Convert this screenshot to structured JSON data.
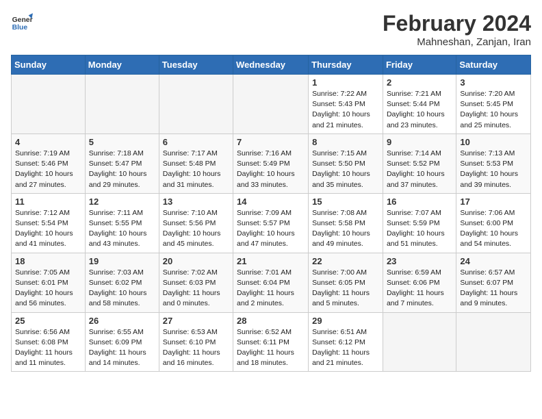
{
  "header": {
    "logo": "GeneralBlue",
    "month": "February 2024",
    "location": "Mahneshan, Zanjan, Iran"
  },
  "weekdays": [
    "Sunday",
    "Monday",
    "Tuesday",
    "Wednesday",
    "Thursday",
    "Friday",
    "Saturday"
  ],
  "weeks": [
    [
      {
        "day": "",
        "info": ""
      },
      {
        "day": "",
        "info": ""
      },
      {
        "day": "",
        "info": ""
      },
      {
        "day": "",
        "info": ""
      },
      {
        "day": "1",
        "info": "Sunrise: 7:22 AM\nSunset: 5:43 PM\nDaylight: 10 hours\nand 21 minutes."
      },
      {
        "day": "2",
        "info": "Sunrise: 7:21 AM\nSunset: 5:44 PM\nDaylight: 10 hours\nand 23 minutes."
      },
      {
        "day": "3",
        "info": "Sunrise: 7:20 AM\nSunset: 5:45 PM\nDaylight: 10 hours\nand 25 minutes."
      }
    ],
    [
      {
        "day": "4",
        "info": "Sunrise: 7:19 AM\nSunset: 5:46 PM\nDaylight: 10 hours\nand 27 minutes."
      },
      {
        "day": "5",
        "info": "Sunrise: 7:18 AM\nSunset: 5:47 PM\nDaylight: 10 hours\nand 29 minutes."
      },
      {
        "day": "6",
        "info": "Sunrise: 7:17 AM\nSunset: 5:48 PM\nDaylight: 10 hours\nand 31 minutes."
      },
      {
        "day": "7",
        "info": "Sunrise: 7:16 AM\nSunset: 5:49 PM\nDaylight: 10 hours\nand 33 minutes."
      },
      {
        "day": "8",
        "info": "Sunrise: 7:15 AM\nSunset: 5:50 PM\nDaylight: 10 hours\nand 35 minutes."
      },
      {
        "day": "9",
        "info": "Sunrise: 7:14 AM\nSunset: 5:52 PM\nDaylight: 10 hours\nand 37 minutes."
      },
      {
        "day": "10",
        "info": "Sunrise: 7:13 AM\nSunset: 5:53 PM\nDaylight: 10 hours\nand 39 minutes."
      }
    ],
    [
      {
        "day": "11",
        "info": "Sunrise: 7:12 AM\nSunset: 5:54 PM\nDaylight: 10 hours\nand 41 minutes."
      },
      {
        "day": "12",
        "info": "Sunrise: 7:11 AM\nSunset: 5:55 PM\nDaylight: 10 hours\nand 43 minutes."
      },
      {
        "day": "13",
        "info": "Sunrise: 7:10 AM\nSunset: 5:56 PM\nDaylight: 10 hours\nand 45 minutes."
      },
      {
        "day": "14",
        "info": "Sunrise: 7:09 AM\nSunset: 5:57 PM\nDaylight: 10 hours\nand 47 minutes."
      },
      {
        "day": "15",
        "info": "Sunrise: 7:08 AM\nSunset: 5:58 PM\nDaylight: 10 hours\nand 49 minutes."
      },
      {
        "day": "16",
        "info": "Sunrise: 7:07 AM\nSunset: 5:59 PM\nDaylight: 10 hours\nand 51 minutes."
      },
      {
        "day": "17",
        "info": "Sunrise: 7:06 AM\nSunset: 6:00 PM\nDaylight: 10 hours\nand 54 minutes."
      }
    ],
    [
      {
        "day": "18",
        "info": "Sunrise: 7:05 AM\nSunset: 6:01 PM\nDaylight: 10 hours\nand 56 minutes."
      },
      {
        "day": "19",
        "info": "Sunrise: 7:03 AM\nSunset: 6:02 PM\nDaylight: 10 hours\nand 58 minutes."
      },
      {
        "day": "20",
        "info": "Sunrise: 7:02 AM\nSunset: 6:03 PM\nDaylight: 11 hours\nand 0 minutes."
      },
      {
        "day": "21",
        "info": "Sunrise: 7:01 AM\nSunset: 6:04 PM\nDaylight: 11 hours\nand 2 minutes."
      },
      {
        "day": "22",
        "info": "Sunrise: 7:00 AM\nSunset: 6:05 PM\nDaylight: 11 hours\nand 5 minutes."
      },
      {
        "day": "23",
        "info": "Sunrise: 6:59 AM\nSunset: 6:06 PM\nDaylight: 11 hours\nand 7 minutes."
      },
      {
        "day": "24",
        "info": "Sunrise: 6:57 AM\nSunset: 6:07 PM\nDaylight: 11 hours\nand 9 minutes."
      }
    ],
    [
      {
        "day": "25",
        "info": "Sunrise: 6:56 AM\nSunset: 6:08 PM\nDaylight: 11 hours\nand 11 minutes."
      },
      {
        "day": "26",
        "info": "Sunrise: 6:55 AM\nSunset: 6:09 PM\nDaylight: 11 hours\nand 14 minutes."
      },
      {
        "day": "27",
        "info": "Sunrise: 6:53 AM\nSunset: 6:10 PM\nDaylight: 11 hours\nand 16 minutes."
      },
      {
        "day": "28",
        "info": "Sunrise: 6:52 AM\nSunset: 6:11 PM\nDaylight: 11 hours\nand 18 minutes."
      },
      {
        "day": "29",
        "info": "Sunrise: 6:51 AM\nSunset: 6:12 PM\nDaylight: 11 hours\nand 21 minutes."
      },
      {
        "day": "",
        "info": ""
      },
      {
        "day": "",
        "info": ""
      }
    ]
  ]
}
